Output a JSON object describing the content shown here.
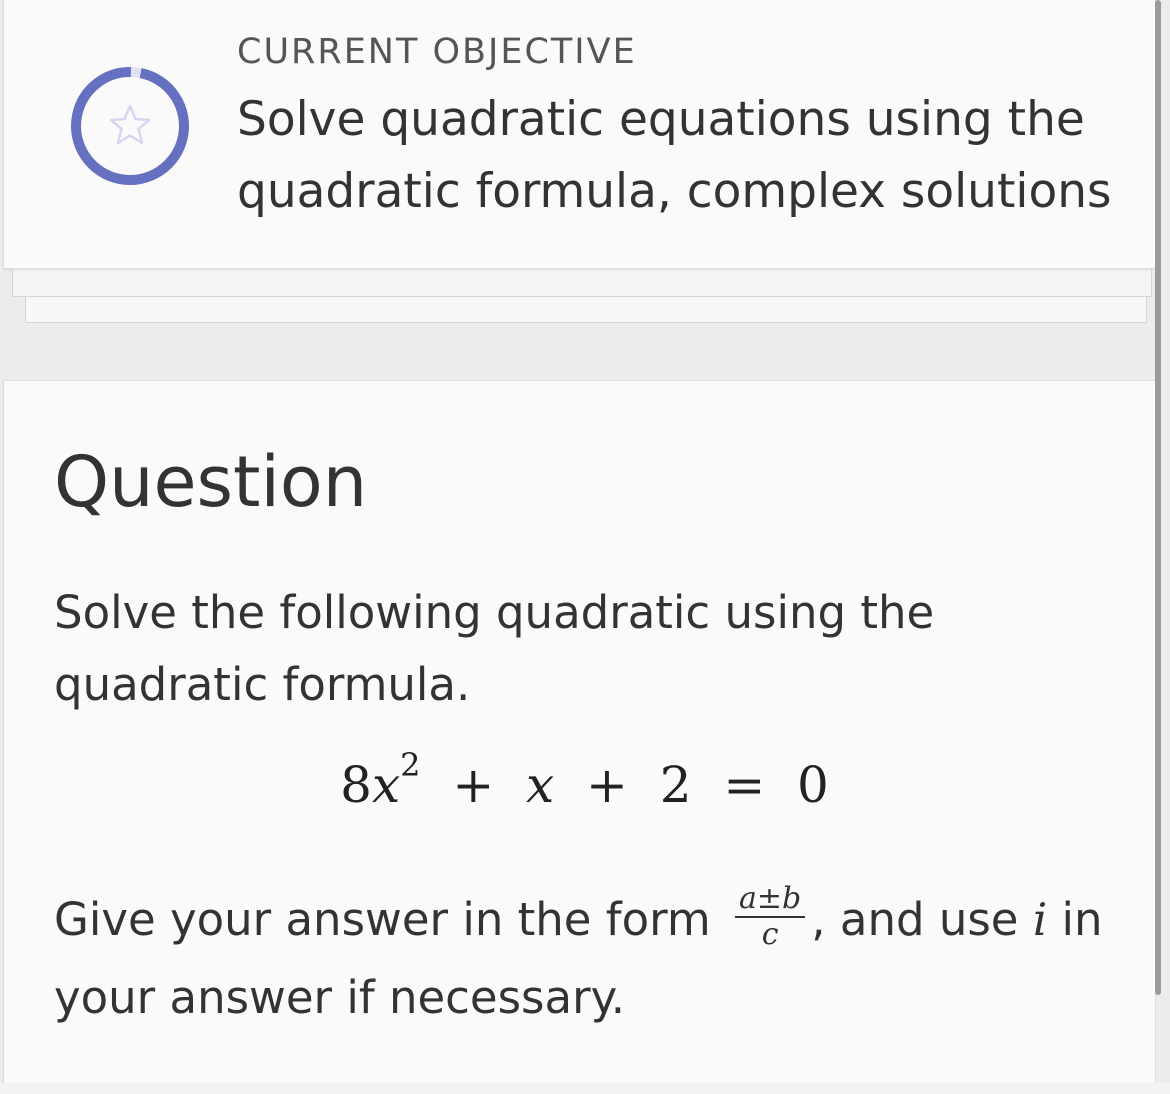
{
  "objective": {
    "kicker": "CURRENT OBJECTIVE",
    "title": "Solve quadratic equations using the quadratic formula, complex solutions",
    "progress_fraction": 0.97,
    "ring_color": "#6670c0",
    "star_icon": "star-outline-icon"
  },
  "question": {
    "heading": "Question",
    "prompt": "Solve the following quadratic using the quadratic formula.",
    "equation": {
      "coef": "8",
      "var": "x",
      "exp": "2",
      "plus1": "+",
      "term2": "x",
      "plus2": "+",
      "const": "2",
      "equals": "=",
      "rhs": "0"
    },
    "instructions": {
      "before": "Give your answer in the form",
      "frac_num": "a±b",
      "frac_den": "c",
      "middle": ", and use",
      "imaginary": "i",
      "after": "in your answer if necessary."
    }
  }
}
